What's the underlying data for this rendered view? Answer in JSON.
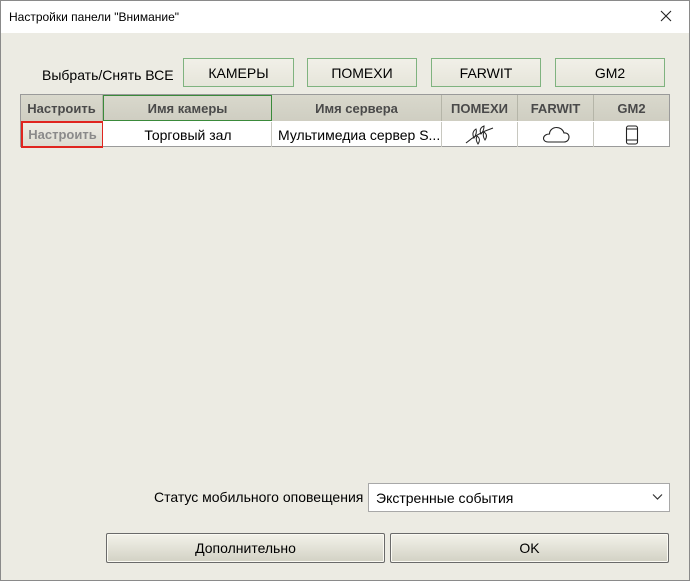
{
  "window": {
    "title": "Настройки панели \"Внимание\""
  },
  "select_all": {
    "label": "Выбрать/Снять ВСЕ",
    "buttons": [
      "КАМЕРЫ",
      "ПОМЕХИ",
      "FARWIT",
      "GM2"
    ]
  },
  "table": {
    "headers": [
      "Настроить",
      "Имя камеры",
      "Имя сервера",
      "ПОМЕХИ",
      "FARWIT",
      "GM2"
    ],
    "rows": [
      {
        "setup": "Настроить",
        "camera": "Торговый зал",
        "server": "Мультимедиа сервер S...",
        "icons": [
          "interference-icon",
          "cloud-icon",
          "mobile-phone-icon"
        ]
      }
    ]
  },
  "status": {
    "label": "Статус мобильного оповещения",
    "value": "Экстренные события"
  },
  "footer": {
    "more_label": "Дополнительно",
    "ok_label": "OK"
  },
  "colors": {
    "highlight_border": "#e0251f",
    "selected_header_border": "#3a8a3a",
    "top_button_border": "#7fb37f"
  }
}
